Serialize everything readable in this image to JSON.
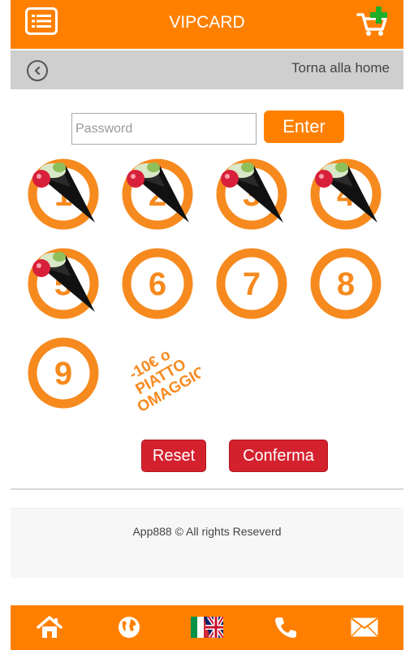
{
  "header": {
    "title": "VIPCARD",
    "menu_icon": "list-menu-icon",
    "cart_icon": "cart-add-icon"
  },
  "subheader": {
    "back_icon": "back-circle-icon",
    "home_link": "Torna alla home"
  },
  "password": {
    "placeholder": "Password",
    "value": "",
    "enter_label": "Enter"
  },
  "stamps": [
    {
      "number": "1",
      "stamped": true
    },
    {
      "number": "2",
      "stamped": true
    },
    {
      "number": "3",
      "stamped": true
    },
    {
      "number": "4",
      "stamped": true
    },
    {
      "number": "5",
      "stamped": true
    },
    {
      "number": "6",
      "stamped": false
    },
    {
      "number": "7",
      "stamped": false
    },
    {
      "number": "8",
      "stamped": false
    },
    {
      "number": "9",
      "stamped": false
    }
  ],
  "reward": {
    "line1": "-10€ o",
    "line2": "PIATTO",
    "line3": "OMAGGIO"
  },
  "actions": {
    "reset_label": "Reset",
    "confirm_label": "Conferma"
  },
  "footer": {
    "copyright": "App888 © All rights Reseverd"
  },
  "bottom_nav": [
    {
      "icon": "home-icon"
    },
    {
      "icon": "globe-icon"
    },
    {
      "icon": "flag-icon"
    },
    {
      "icon": "phone-icon"
    },
    {
      "icon": "mail-icon"
    }
  ],
  "colors": {
    "accent": "#ff8000",
    "danger": "#d4212e",
    "subbar": "#cfcfcf"
  }
}
